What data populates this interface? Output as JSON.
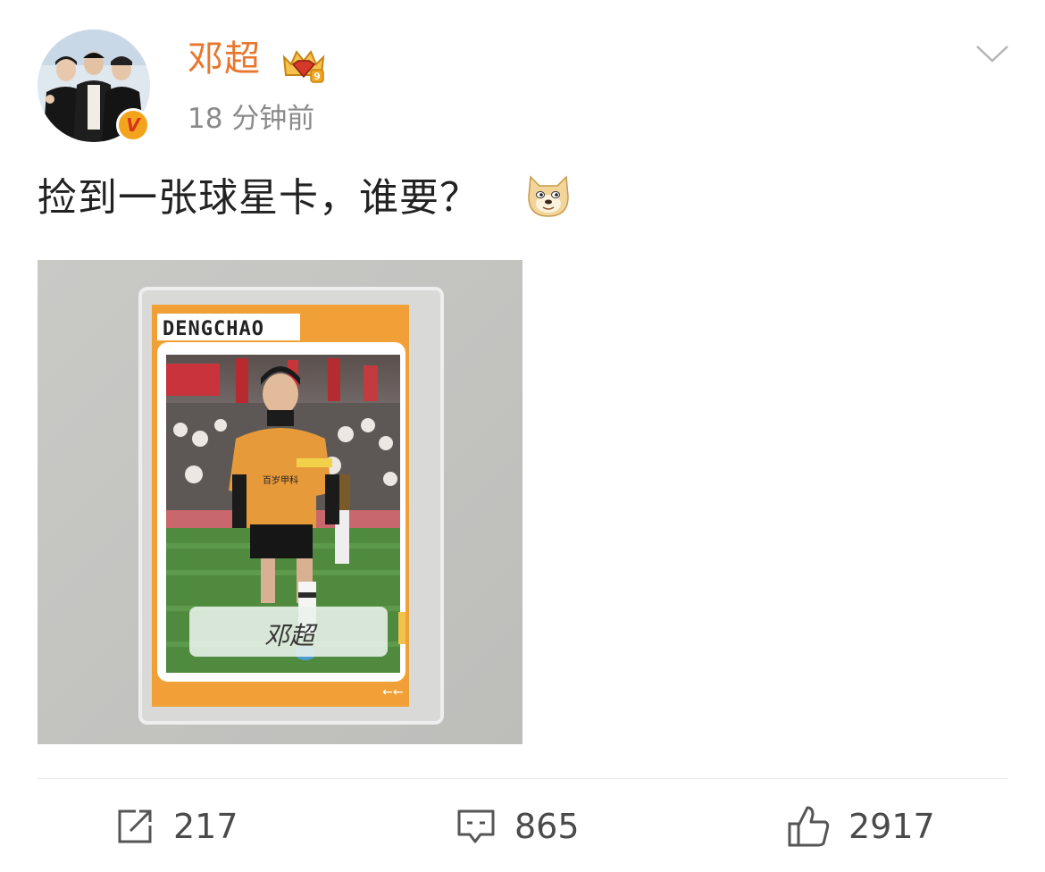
{
  "post": {
    "author": {
      "name": "邓超",
      "avatar_icon": "avatar-photo",
      "verified_icon": "verified-v-badge",
      "verified_text": "V",
      "vip_icon": "vip-crown-badge",
      "vip_level": "9"
    },
    "timestamp": "18 分钟前",
    "text": "捡到一张球星卡，谁要？",
    "emoji_icon": "doge-emoji",
    "image": {
      "card_name_banner": "DENGCHAO",
      "signature": "邓超",
      "jersey_sponsor": "百岁甲科"
    },
    "menu_icon": "chevron-down-icon"
  },
  "actions": {
    "repost": {
      "icon": "repost-icon",
      "count": "217"
    },
    "comment": {
      "icon": "comment-icon",
      "count": "865"
    },
    "like": {
      "icon": "like-thumb-icon",
      "count": "2917"
    }
  },
  "colors": {
    "username": "#e8762d",
    "timestamp": "#8a8a8a",
    "card_orange": "#f0a037",
    "text": "#222222"
  }
}
